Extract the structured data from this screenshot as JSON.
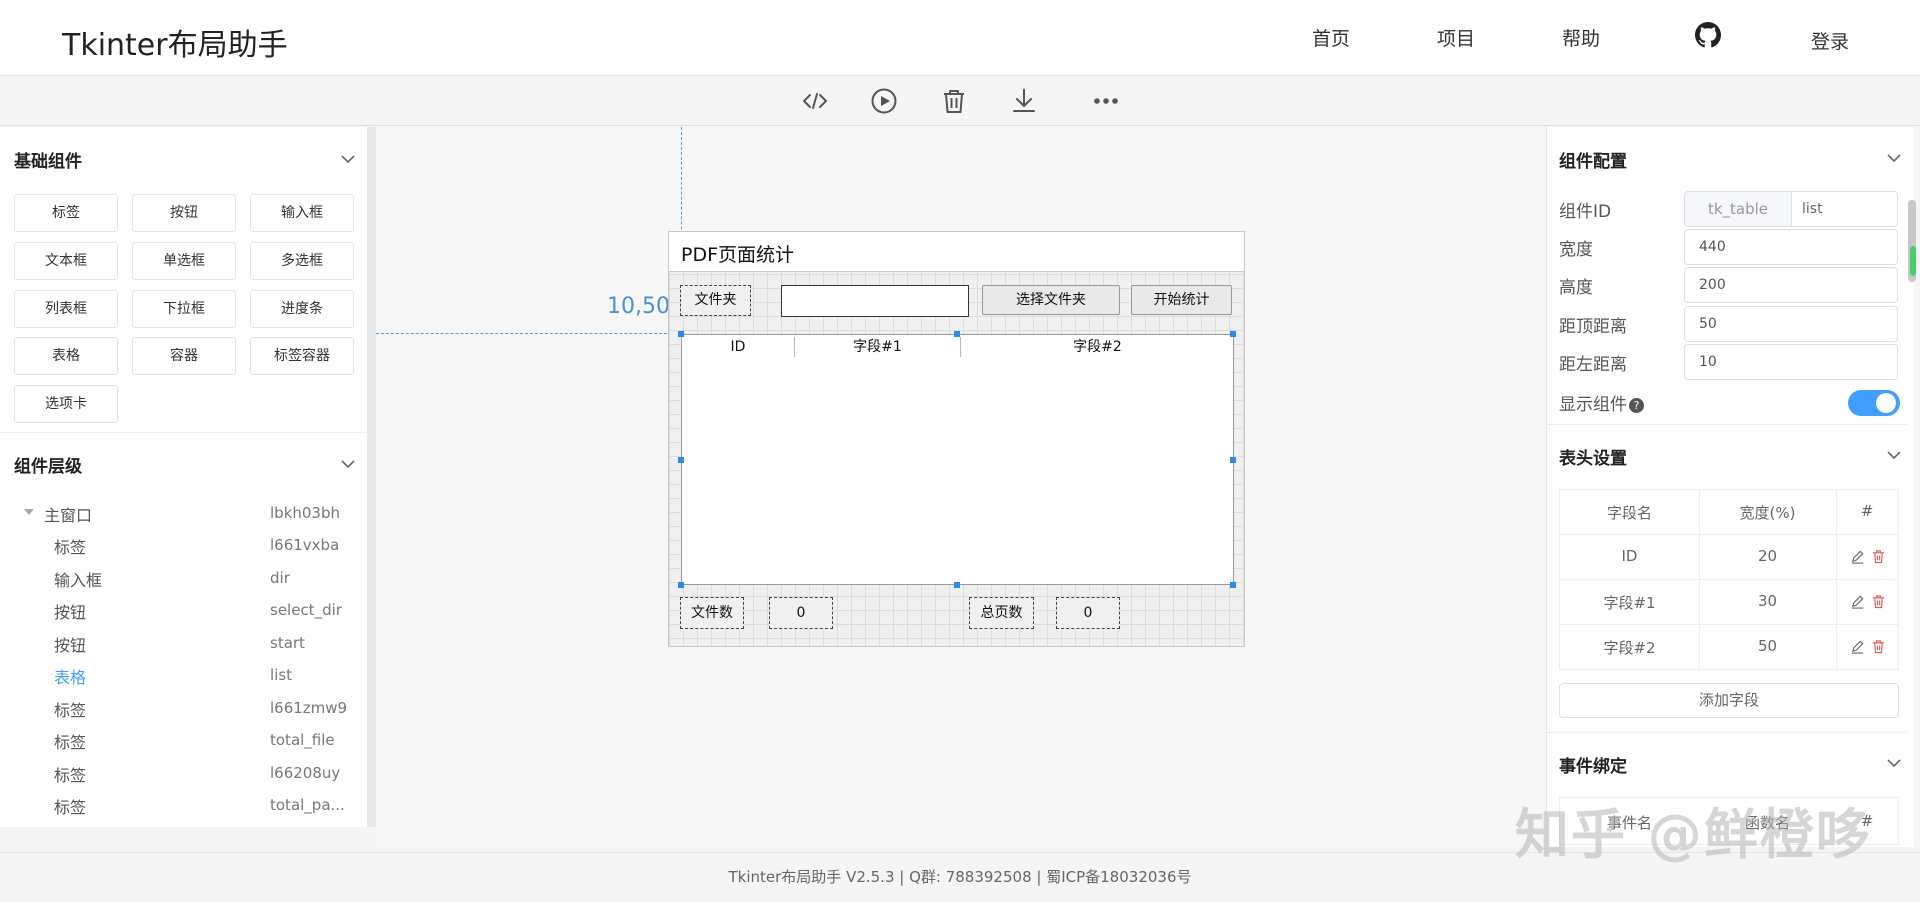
{
  "header": {
    "brand": "Tkinter布局助手",
    "nav": [
      "首页",
      "项目",
      "帮助"
    ],
    "login": "登录"
  },
  "toolbar": {
    "icons": [
      "code-icon",
      "play-icon",
      "trash-icon",
      "download-icon",
      "more-icon"
    ]
  },
  "left": {
    "basic_title": "基础组件",
    "widgets": [
      "标签",
      "按钮",
      "输入框",
      "文本框",
      "单选框",
      "多选框",
      "列表框",
      "下拉框",
      "进度条",
      "表格",
      "容器",
      "标签容器",
      "选项卡"
    ],
    "hierarchy_title": "组件层级",
    "tree": [
      {
        "label": "主窗口",
        "id": "lbkh03bh"
      },
      {
        "label": "标签",
        "id": "l661vxba"
      },
      {
        "label": "输入框",
        "id": "dir"
      },
      {
        "label": "按钮",
        "id": "select_dir"
      },
      {
        "label": "按钮",
        "id": "start"
      },
      {
        "label": "表格",
        "id": "list"
      },
      {
        "label": "标签",
        "id": "l661zmw9"
      },
      {
        "label": "标签",
        "id": "total_file"
      },
      {
        "label": "标签",
        "id": "l66208uy"
      },
      {
        "label": "标签",
        "id": "total_pa..."
      }
    ],
    "active_tree_index": 5
  },
  "canvas": {
    "coord": "10,50",
    "window_title": "PDF页面统计",
    "folder_label": "文件夹",
    "select_btn": "选择文件夹",
    "start_btn": "开始统计",
    "columns": [
      "ID",
      "字段#1",
      "字段#2"
    ],
    "file_count_label": "文件数",
    "file_count_value": "0",
    "page_count_label": "总页数",
    "page_count_value": "0"
  },
  "right": {
    "config_title": "组件配置",
    "id_label": "组件ID",
    "id_prefix": "tk_table",
    "id_value": "list",
    "width_label": "宽度",
    "width_value": "440",
    "height_label": "高度",
    "height_value": "200",
    "top_label": "距顶距离",
    "top_value": "50",
    "left_label": "距左距离",
    "left_value": "10",
    "show_label": "显示组件",
    "show_enabled": true,
    "header_title": "表头设置",
    "field_cols": [
      "字段名",
      "宽度(%)",
      "#"
    ],
    "fields": [
      {
        "name": "ID",
        "width": "20"
      },
      {
        "name": "字段#1",
        "width": "30"
      },
      {
        "name": "字段#2",
        "width": "50"
      }
    ],
    "add_field": "添加字段",
    "event_title": "事件绑定",
    "event_cols": [
      "事件名",
      "函数名",
      "#"
    ]
  },
  "footer": {
    "text": "Tkinter布局助手 V2.5.3 | Q群: 788392508 | 蜀ICP备18032036号"
  },
  "watermark": "知乎 @鲜橙哆",
  "colors": {
    "accent": "#409eff",
    "guide": "#4a90d9",
    "handle": "#2d8ceb",
    "delete": "#e05555"
  }
}
